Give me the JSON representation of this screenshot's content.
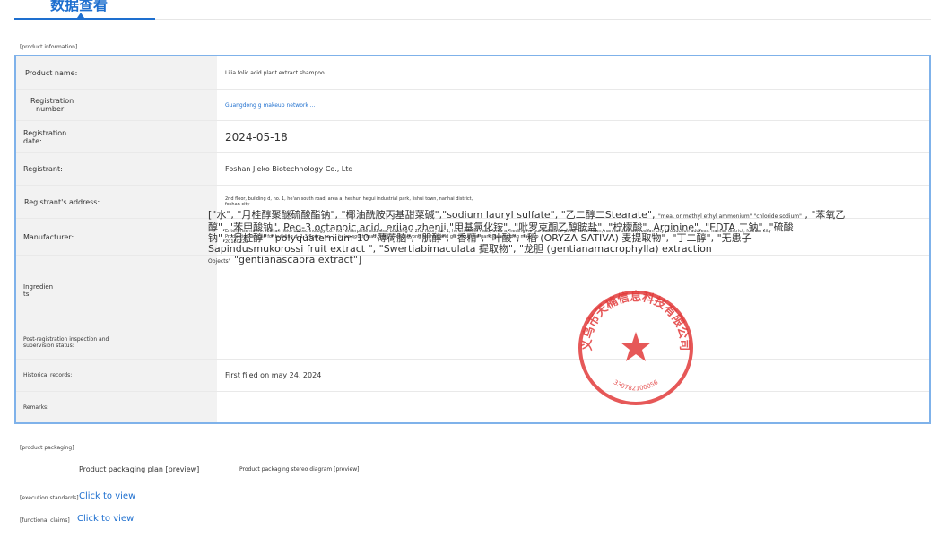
{
  "tab": {
    "label": "数据查看"
  },
  "sections": {
    "product_information": "[product information]",
    "product_packaging": "[product packaging]"
  },
  "rows": {
    "product_name": {
      "label": "Product name:",
      "value": "Lilia folic acid plant extract shampoo"
    },
    "registration_number": {
      "label_line1": "Registration",
      "label_line2": "number:",
      "value": "Guangdong g makeup network ..."
    },
    "registration_date": {
      "label_line1": "Registration",
      "label_line2": "date:",
      "value": "2024-05-18"
    },
    "registrant": {
      "label": "Registrant:",
      "value": "Foshan Jieko Biotechnology Co., Ltd"
    },
    "registrant_address": {
      "label": "Registrant's address:",
      "value_line1": "2nd floor, building d, no. 1, he'an south road, area a, heshun hegui industrial park, lishui town, nanhai district,",
      "value_line2": "foshan city"
    },
    "manufacturer": {
      "label": "Manufacturer:",
      "value_line1": "Enterprise name: foshan jieko biotechnology co., ltd. enterprise address: building d, 2nd floor, no. 1, he'an south road, area a, heding he gui industrial park, lishui town, nanhai district, foshan city production address: nanhai district, foshan city",
      "value_line2": "Production license for building d, 1-3 floors, no. 1, he'an south road, area a, chongyong heshun and gui industrial park: guangdong makeup",
      "value_line3": "20180229"
    },
    "ingredients": {
      "label_line1": "Ingredien",
      "label_line2": "ts:",
      "line1": "[\"水\", \"月桂醇聚醚硫酸酯钠\", \"椰油酰胺丙基甜菜碱\",\"sodium lauryl sulfate\", \"乙二醇二Stearate\",",
      "line1_small": "\"mea, or methyl ethyl ammonium\" \"chloride sodium\"",
      "line1_end": ", \"苯氧乙",
      "line2": "醇\", \"苯甲酸钠\", Peg-3 octanoic acid, erjiao zhenji \"甲基氯化铵\", \"吡罗克酮乙醇胺盐\", \"柠檬酸\", Arginine\", \"EDTA 二钠\", \"硫酸",
      "line3": "钠\", \"月桂醇\" \"polyquaternium-10 \"薄荷脑\", \"肌醇\", \"香精\", \"叶酸\", \"稻 (ORYZA SATIVA) 麦提取物\", \"丁二醇\", \"无患子",
      "line4": "Sapindusmukorossi fruit extract \", \"Swertiabimaculata 提取物\", \"龙胆 (gentianamacrophylla) extraction",
      "line5_small": "Objects\"",
      "line5": "\"gentianascabra extract\"]"
    },
    "post_registration": {
      "label_line1": "Post-registration inspection and",
      "label_line2": "supervision status:",
      "value": ""
    },
    "historical_records": {
      "label": "Historical records:",
      "value": "First filed on may 24, 2024"
    },
    "remarks": {
      "label": "Remarks:",
      "value": ""
    }
  },
  "seal": {
    "text": "义乌市天楠信息科技有限公司",
    "number": "330782100056",
    "color": "#e23b3b"
  },
  "packaging": {
    "plan_label": "Product packaging plan [preview]",
    "stereo_label": "Product packaging stereo diagram [preview]"
  },
  "standards": {
    "execution_label": "[execution standards]",
    "execution_link": "Click to view",
    "functional_label": "[functional claims]",
    "functional_link": "Click to view"
  }
}
